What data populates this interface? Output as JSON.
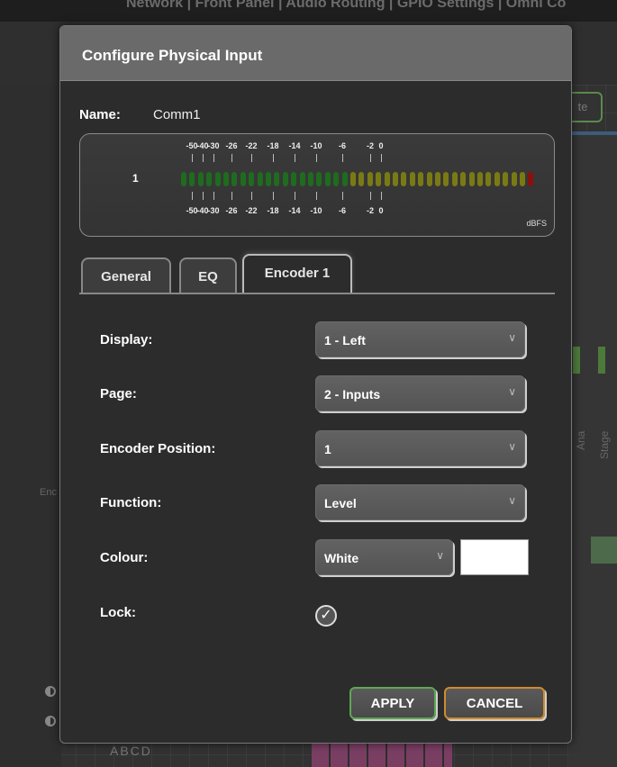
{
  "background": {
    "topbar_text": "Network | Front Panel | Audio Routing | GPIO Settings | Omni Co",
    "right_button_label": "te",
    "vertical_label_a": "Ana",
    "vertical_label_b": "Stage",
    "enc_label": "Enc",
    "bottom_text": "ABCD"
  },
  "dialog": {
    "title": "Configure Physical Input",
    "name_label": "Name:",
    "name_value": "Comm1",
    "meter": {
      "channel": "1",
      "scale_top": [
        "-50",
        "-40",
        "-30",
        "-26",
        "-22",
        "-18",
        "-14",
        "-10",
        "-6",
        "-2",
        "0"
      ],
      "scale_bottom": [
        "-50",
        "-40",
        "-30",
        "-26",
        "-22",
        "-18",
        "-14",
        "-10",
        "-6",
        "-2",
        "0"
      ],
      "unit": "dBFS",
      "segment_colors": {
        "green": "#1f6b1f",
        "yellow": "#7a7a14",
        "red": "#8a1010"
      }
    },
    "tabs": [
      {
        "label": "General",
        "active": false
      },
      {
        "label": "EQ",
        "active": false
      },
      {
        "label": "Encoder 1",
        "active": true
      }
    ],
    "fields": {
      "display": {
        "label": "Display:",
        "value": "1 - Left"
      },
      "page": {
        "label": "Page:",
        "value": "2 - Inputs"
      },
      "encoder_position": {
        "label": "Encoder Position:",
        "value": "1"
      },
      "function": {
        "label": "Function:",
        "value": "Level"
      },
      "colour": {
        "label": "Colour:",
        "value": "White",
        "swatch": "#ffffff"
      },
      "lock": {
        "label": "Lock:",
        "checked": true
      }
    },
    "buttons": {
      "apply": "APPLY",
      "cancel": "CANCEL"
    }
  }
}
